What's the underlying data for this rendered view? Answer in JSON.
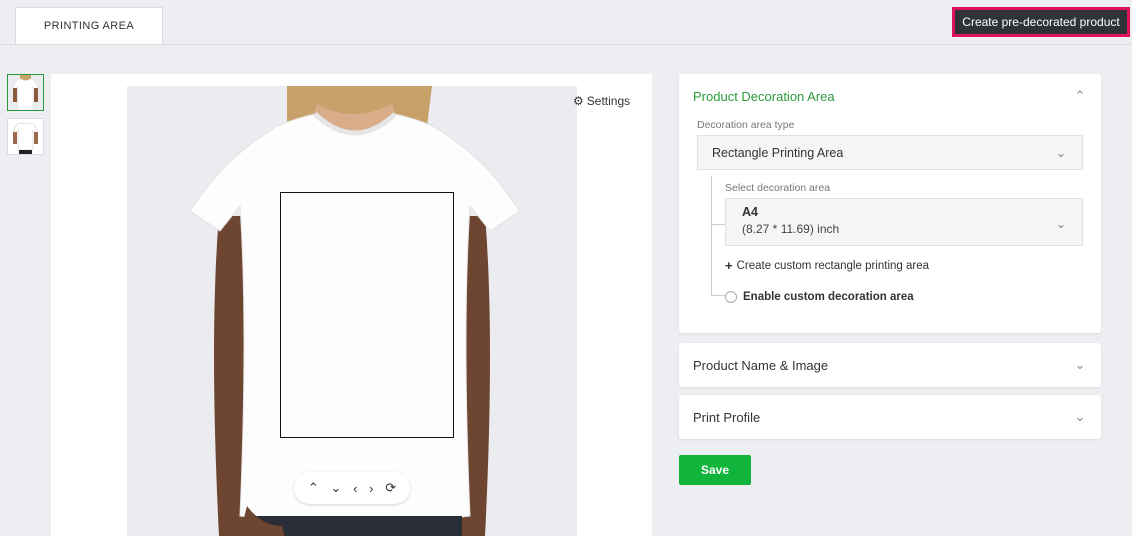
{
  "header": {
    "tab_label": "PRINTING AREA",
    "cta_label": "Create pre-decorated product"
  },
  "canvas": {
    "settings_label": "Settings"
  },
  "panel": {
    "decoration": {
      "title": "Product Decoration Area",
      "type_label": "Decoration area type",
      "type_value": "Rectangle Printing Area",
      "area_label": "Select decoration area",
      "area_name": "A4",
      "area_size": "(8.27 * 11.69) inch",
      "create_link": "Create custom rectangle printing area",
      "enable_label": "Enable custom decoration area"
    },
    "name_image_title": "Product Name & Image",
    "print_profile_title": "Print Profile"
  },
  "actions": {
    "save_label": "Save"
  },
  "colors": {
    "accent_green": "#2b9a3c",
    "save_green": "#11b53b",
    "cta_border": "#e0125e"
  }
}
